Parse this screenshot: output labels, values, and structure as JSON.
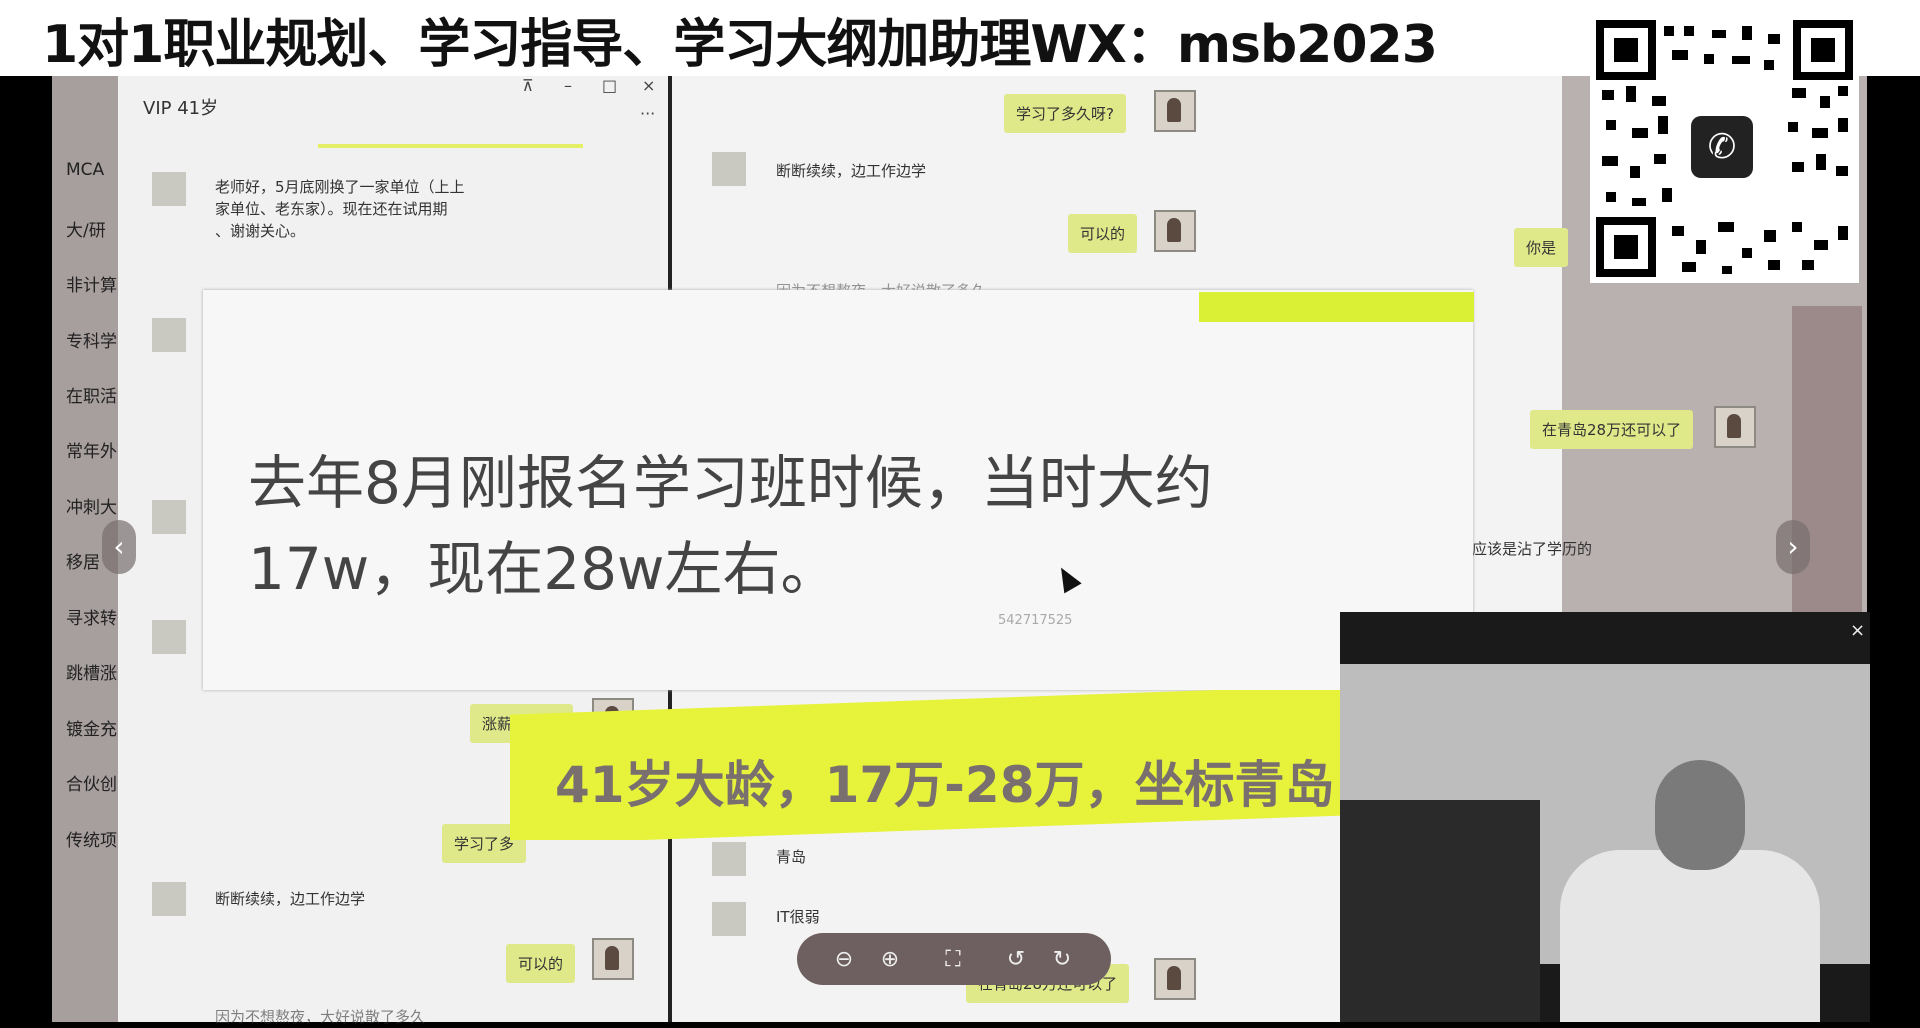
{
  "banner": {
    "text": "1对1职业规划、学习指导、学习大纲加助理WX：msb2023"
  },
  "window": {
    "title": "VIP      41岁",
    "controls": [
      "⊼",
      "–",
      "□",
      "×"
    ],
    "more": "···"
  },
  "sidebar": {
    "items": [
      {
        "label": "MCA"
      },
      {
        "label": "大/研"
      },
      {
        "label": "非计算"
      },
      {
        "label": "专科学"
      },
      {
        "label": "在职活"
      },
      {
        "label": "常年外"
      },
      {
        "label": "冲刺大"
      },
      {
        "label": "移居"
      },
      {
        "label": "寻求转"
      },
      {
        "label": "跳槽涨"
      },
      {
        "label": "镀金充"
      },
      {
        "label": "合伙创"
      },
      {
        "label": "传统项"
      }
    ]
  },
  "chat_left": {
    "messages": [
      {
        "text": "老师好，5月底刚换了一家单位（上上\n家单位、老东家）。现在还在试用期\n、谢谢关心。"
      },
      {
        "text": "涨薪了11万"
      },
      {
        "text": "学习了多"
      },
      {
        "text": "断断续续，边工作边学"
      },
      {
        "text": "可以的"
      },
      {
        "text": "因为不想熬夜，大好说散了多久"
      }
    ]
  },
  "chat_right": {
    "messages": [
      {
        "text": "学习了多久呀?"
      },
      {
        "text": "断断续续，边工作边学"
      },
      {
        "text": "可以的"
      },
      {
        "text": "你是"
      },
      {
        "text": "因为不想熬夜，大好说散了多久"
      },
      {
        "text": "在青岛28万还可以了"
      },
      {
        "text": "应该是沾了学历的"
      },
      {
        "text": "青岛"
      },
      {
        "text": "IT很弱"
      },
      {
        "text": "在青岛28万还可以了"
      }
    ]
  },
  "popup": {
    "line1": "去年8月刚报名学习班时候，当时大约",
    "line2": "17w，现在28w左右。",
    "id": "542717525"
  },
  "caption": {
    "text": "41岁大龄，17万-28万，坐标青岛"
  },
  "toolbar": {
    "zoom_out": "⊖",
    "zoom_in": "⊕",
    "fit": "⛶",
    "rotate_left": "↺",
    "rotate_right": "↻"
  },
  "nav": {
    "prev": "‹",
    "next": "›"
  },
  "video": {
    "close": "×"
  },
  "colors": {
    "highlight": "#e6f33a",
    "bubble": "#dfe98a"
  }
}
